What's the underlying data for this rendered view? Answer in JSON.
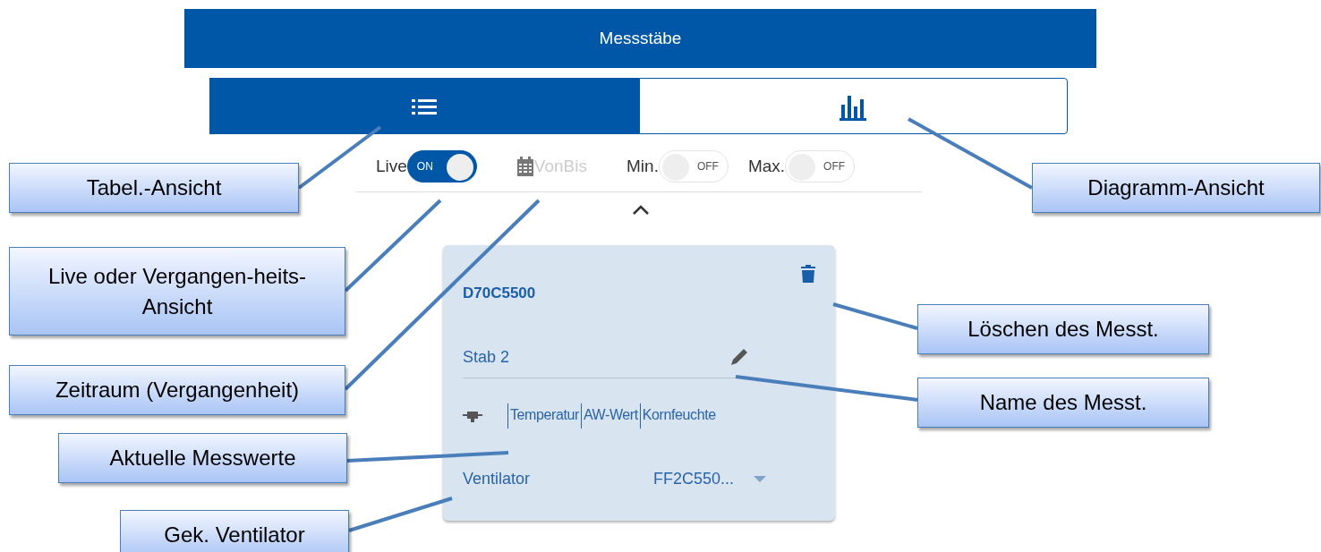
{
  "header": {
    "title": "Messstäbe"
  },
  "tabs": [
    {
      "kind": "list",
      "selected": true
    },
    {
      "kind": "chart",
      "selected": false
    }
  ],
  "filters": [
    {
      "kind": "switch",
      "label": "Live",
      "on": true,
      "state_label": "ON"
    },
    {
      "kind": "date",
      "label": "VonBis",
      "disabled": true
    },
    {
      "kind": "switch",
      "label": "Min.",
      "on": false,
      "state_label": "OFF"
    },
    {
      "kind": "switch",
      "label": "Max.",
      "on": false,
      "state_label": "OFF"
    }
  ],
  "card": {
    "id": "D70C5500",
    "name": "Stab 2",
    "sensors": [
      "Temperatur",
      "AW-Wert",
      "Kornfeuchte"
    ],
    "fan_label": "Ventilator",
    "fan_value": "FF2C550..."
  },
  "annotations": [
    {
      "text": "Tabel.-Ansicht"
    },
    {
      "text": "Diagramm-Ansicht"
    },
    {
      "text": "Live oder Vergangen-heits-Ansicht"
    },
    {
      "text": "Zeitraum (Vergangenheit)"
    },
    {
      "text": "Löschen des Messt."
    },
    {
      "text": "Name des Messt."
    },
    {
      "text": "Aktuelle Messwerte"
    },
    {
      "text": "Gek. Ventilator"
    }
  ]
}
